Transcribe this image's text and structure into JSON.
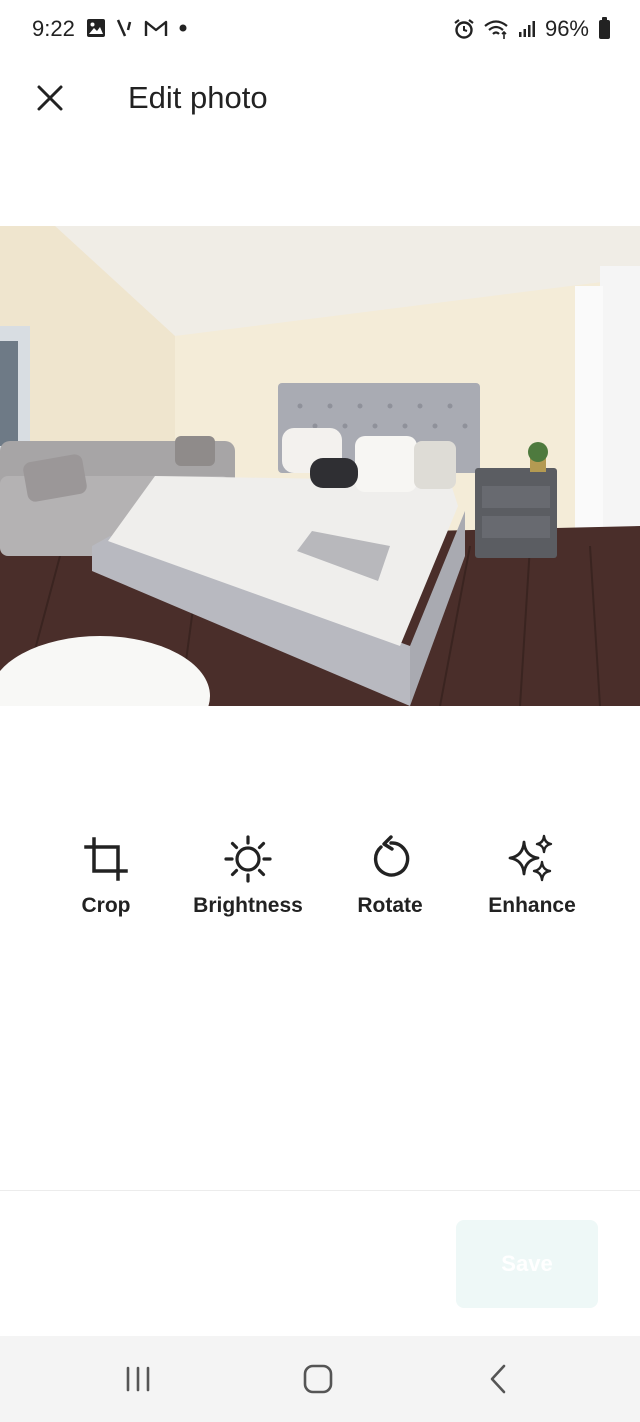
{
  "status_bar": {
    "time": "9:22",
    "battery_percent": "96%",
    "icons_left": [
      "gallery-icon",
      "signal-tool-icon",
      "gmail-icon",
      "dot-icon"
    ],
    "icons_right": [
      "alarm-icon",
      "wifi-icon",
      "cell-signal-icon",
      "battery-icon"
    ]
  },
  "header": {
    "title": "Edit photo",
    "close_icon": "close-icon"
  },
  "photo": {
    "description_icon": "bedroom-photo"
  },
  "tools": [
    {
      "label": "Crop",
      "icon": "crop-icon"
    },
    {
      "label": "Brightness",
      "icon": "brightness-icon"
    },
    {
      "label": "Rotate",
      "icon": "rotate-icon"
    },
    {
      "label": "Enhance",
      "icon": "sparkle-icon"
    }
  ],
  "footer": {
    "save_label": "Save",
    "save_bg": "#eef8f7"
  },
  "nav": {
    "recents_icon": "recents-icon",
    "home_icon": "home-icon",
    "back_icon": "back-icon"
  }
}
